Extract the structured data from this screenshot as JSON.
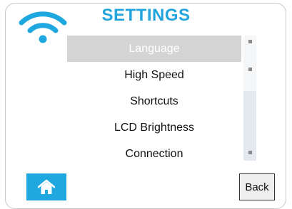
{
  "header": {
    "title": "SETTINGS",
    "wifi_icon": "wifi-icon"
  },
  "menu": {
    "items": [
      {
        "label": "Language",
        "selected": true
      },
      {
        "label": "High Speed",
        "selected": false
      },
      {
        "label": "Shortcuts",
        "selected": false
      },
      {
        "label": "LCD Brightness",
        "selected": false
      },
      {
        "label": "Connection",
        "selected": false
      }
    ]
  },
  "footer": {
    "home_icon": "home-icon",
    "back_label": "Back"
  },
  "colors": {
    "accent": "#22a5dd",
    "selected_bg": "#d4d4d4",
    "scrollbar_track": "#e4e8ef"
  }
}
